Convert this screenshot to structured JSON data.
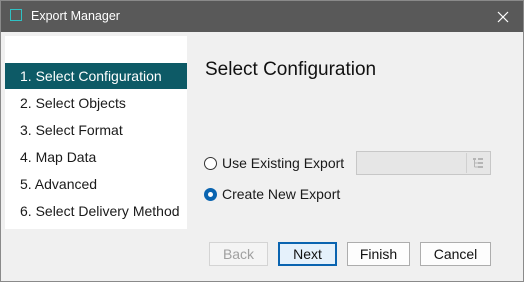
{
  "window": {
    "title": "Export Manager"
  },
  "nav": {
    "items": [
      {
        "label": "1. Select Configuration",
        "selected": true
      },
      {
        "label": "2. Select Objects",
        "selected": false
      },
      {
        "label": "3. Select Format",
        "selected": false
      },
      {
        "label": "4. Map Data",
        "selected": false
      },
      {
        "label": "5. Advanced",
        "selected": false
      },
      {
        "label": "6. Select Delivery Method",
        "selected": false
      }
    ]
  },
  "main": {
    "title": "Select Configuration",
    "options": {
      "use_existing": {
        "label": "Use Existing Export",
        "checked": false
      },
      "create_new": {
        "label": "Create New Export",
        "checked": true
      }
    },
    "existing_export": {
      "value": "",
      "enabled": false
    }
  },
  "buttons": {
    "back": {
      "label": "Back",
      "enabled": false
    },
    "next": {
      "label": "Next",
      "default": true
    },
    "finish": {
      "label": "Finish"
    },
    "cancel": {
      "label": "Cancel"
    }
  },
  "icons": {
    "app": "export-manager-icon",
    "close": "close-icon",
    "combo_browse": "browse-list-icon"
  },
  "colors": {
    "titlebar": "#595959",
    "selection": "#0d5a66",
    "accent": "#0a64b0"
  }
}
